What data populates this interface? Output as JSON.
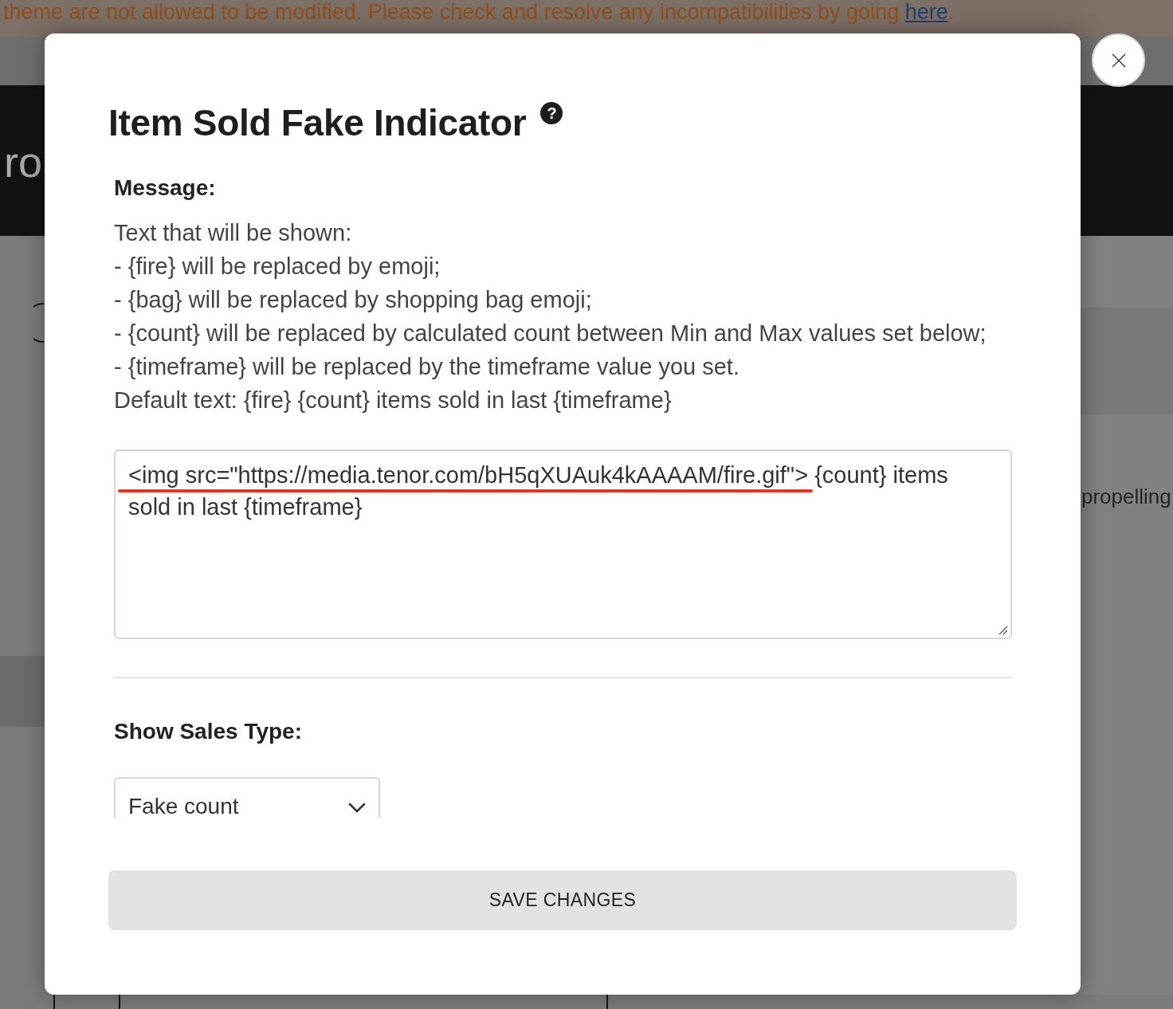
{
  "background_page": {
    "notice": {
      "text": "theme are not allowed to be modified. Please check and resolve any incompatibilities by going",
      "link": "here",
      "end": "."
    },
    "hero_text": "ro",
    "side_text": "propelling"
  },
  "dialog": {
    "title": "Item Sold Fake Indicator",
    "help_icon": "?",
    "message": {
      "label": "Message:",
      "lines": [
        "Text that will be shown:",
        "- {fire} will be replaced by emoji;",
        "- {bag} will be replaced by shopping bag emoji;",
        "- {count} will be replaced by calculated count between Min and Max values set below;",
        "- {timeframe} will be replaced by the timeframe value you set.",
        "Default text: {fire} {count} items sold in last {timeframe}"
      ],
      "field": {
        "value": "<img src=\"https://media.tenor.com/bH5qXUAuk4kAAAAM/fire.gif\"> {count} items sold in last {timeframe}",
        "underline_mark": true
      }
    },
    "sales_type": {
      "label": "Show Sales Type:",
      "select": {
        "value": "Fake count"
      }
    },
    "save_button": "SAVE CHANGES"
  }
}
